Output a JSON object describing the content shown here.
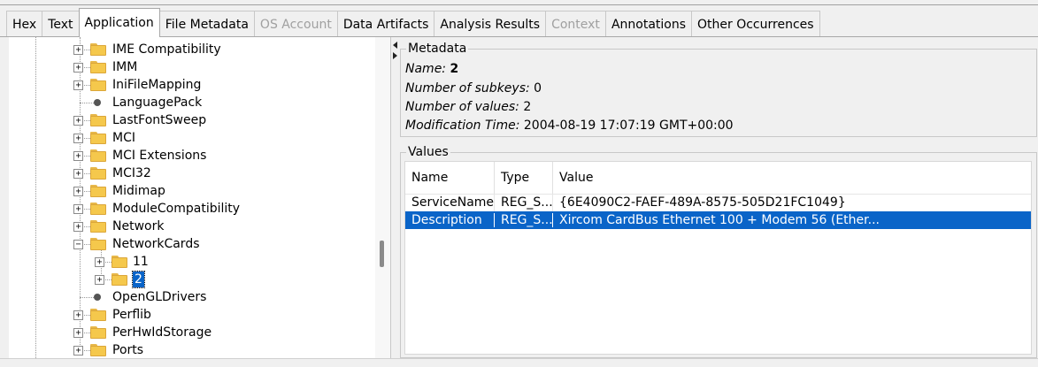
{
  "tabs": [
    {
      "label": "Hex",
      "state": "normal"
    },
    {
      "label": "Text",
      "state": "normal"
    },
    {
      "label": "Application",
      "state": "active"
    },
    {
      "label": "File Metadata",
      "state": "normal"
    },
    {
      "label": "OS Account",
      "state": "disabled"
    },
    {
      "label": "Data Artifacts",
      "state": "normal"
    },
    {
      "label": "Analysis Results",
      "state": "normal"
    },
    {
      "label": "Context",
      "state": "disabled"
    },
    {
      "label": "Annotations",
      "state": "normal"
    },
    {
      "label": "Other Occurrences",
      "state": "normal"
    }
  ],
  "tree": {
    "items": [
      {
        "label": "IME Compatibility",
        "type": "folder",
        "expander": "+"
      },
      {
        "label": "IMM",
        "type": "folder",
        "expander": "+"
      },
      {
        "label": "IniFileMapping",
        "type": "folder",
        "expander": "+"
      },
      {
        "label": "LanguagePack",
        "type": "leaf",
        "expander": ""
      },
      {
        "label": "LastFontSweep",
        "type": "folder",
        "expander": "+"
      },
      {
        "label": "MCI",
        "type": "folder",
        "expander": "+"
      },
      {
        "label": "MCI Extensions",
        "type": "folder",
        "expander": "+"
      },
      {
        "label": "MCI32",
        "type": "folder",
        "expander": "+"
      },
      {
        "label": "Midimap",
        "type": "folder",
        "expander": "+"
      },
      {
        "label": "ModuleCompatibility",
        "type": "folder",
        "expander": "+"
      },
      {
        "label": "Network",
        "type": "folder",
        "expander": "+"
      },
      {
        "label": "NetworkCards",
        "type": "folder",
        "expander": "-"
      },
      {
        "label": "11",
        "type": "folder",
        "expander": "+",
        "child": true
      },
      {
        "label": "2",
        "type": "folder",
        "expander": "+",
        "child": true,
        "selected": true
      },
      {
        "label": "OpenGLDrivers",
        "type": "leaf",
        "expander": ""
      },
      {
        "label": "Perflib",
        "type": "folder",
        "expander": "+"
      },
      {
        "label": "PerHwIdStorage",
        "type": "folder",
        "expander": "+"
      },
      {
        "label": "Ports",
        "type": "folder",
        "expander": "+"
      }
    ]
  },
  "metadata": {
    "title": "Metadata",
    "name_label": "Name:",
    "name_value": "2",
    "subkeys_label": "Number of subkeys:",
    "subkeys_value": "0",
    "values_label": "Number of values:",
    "values_value": "2",
    "mtime_label": "Modification Time:",
    "mtime_value": "2004-08-19 17:07:19 GMT+00:00"
  },
  "values": {
    "title": "Values",
    "columns": [
      "Name",
      "Type",
      "Value"
    ],
    "rows": [
      {
        "name": "ServiceName",
        "type": "REG_S...",
        "value": "{6E4090C2-FAEF-489A-8575-505D21FC1049}",
        "selected": false
      },
      {
        "name": "Description",
        "type": "REG_S...",
        "value": "Xircom CardBus Ethernet 100 + Modem 56 (Ether...",
        "selected": true
      }
    ]
  },
  "colors": {
    "selection": "#0a64c8",
    "folder": "#f5c84c"
  }
}
